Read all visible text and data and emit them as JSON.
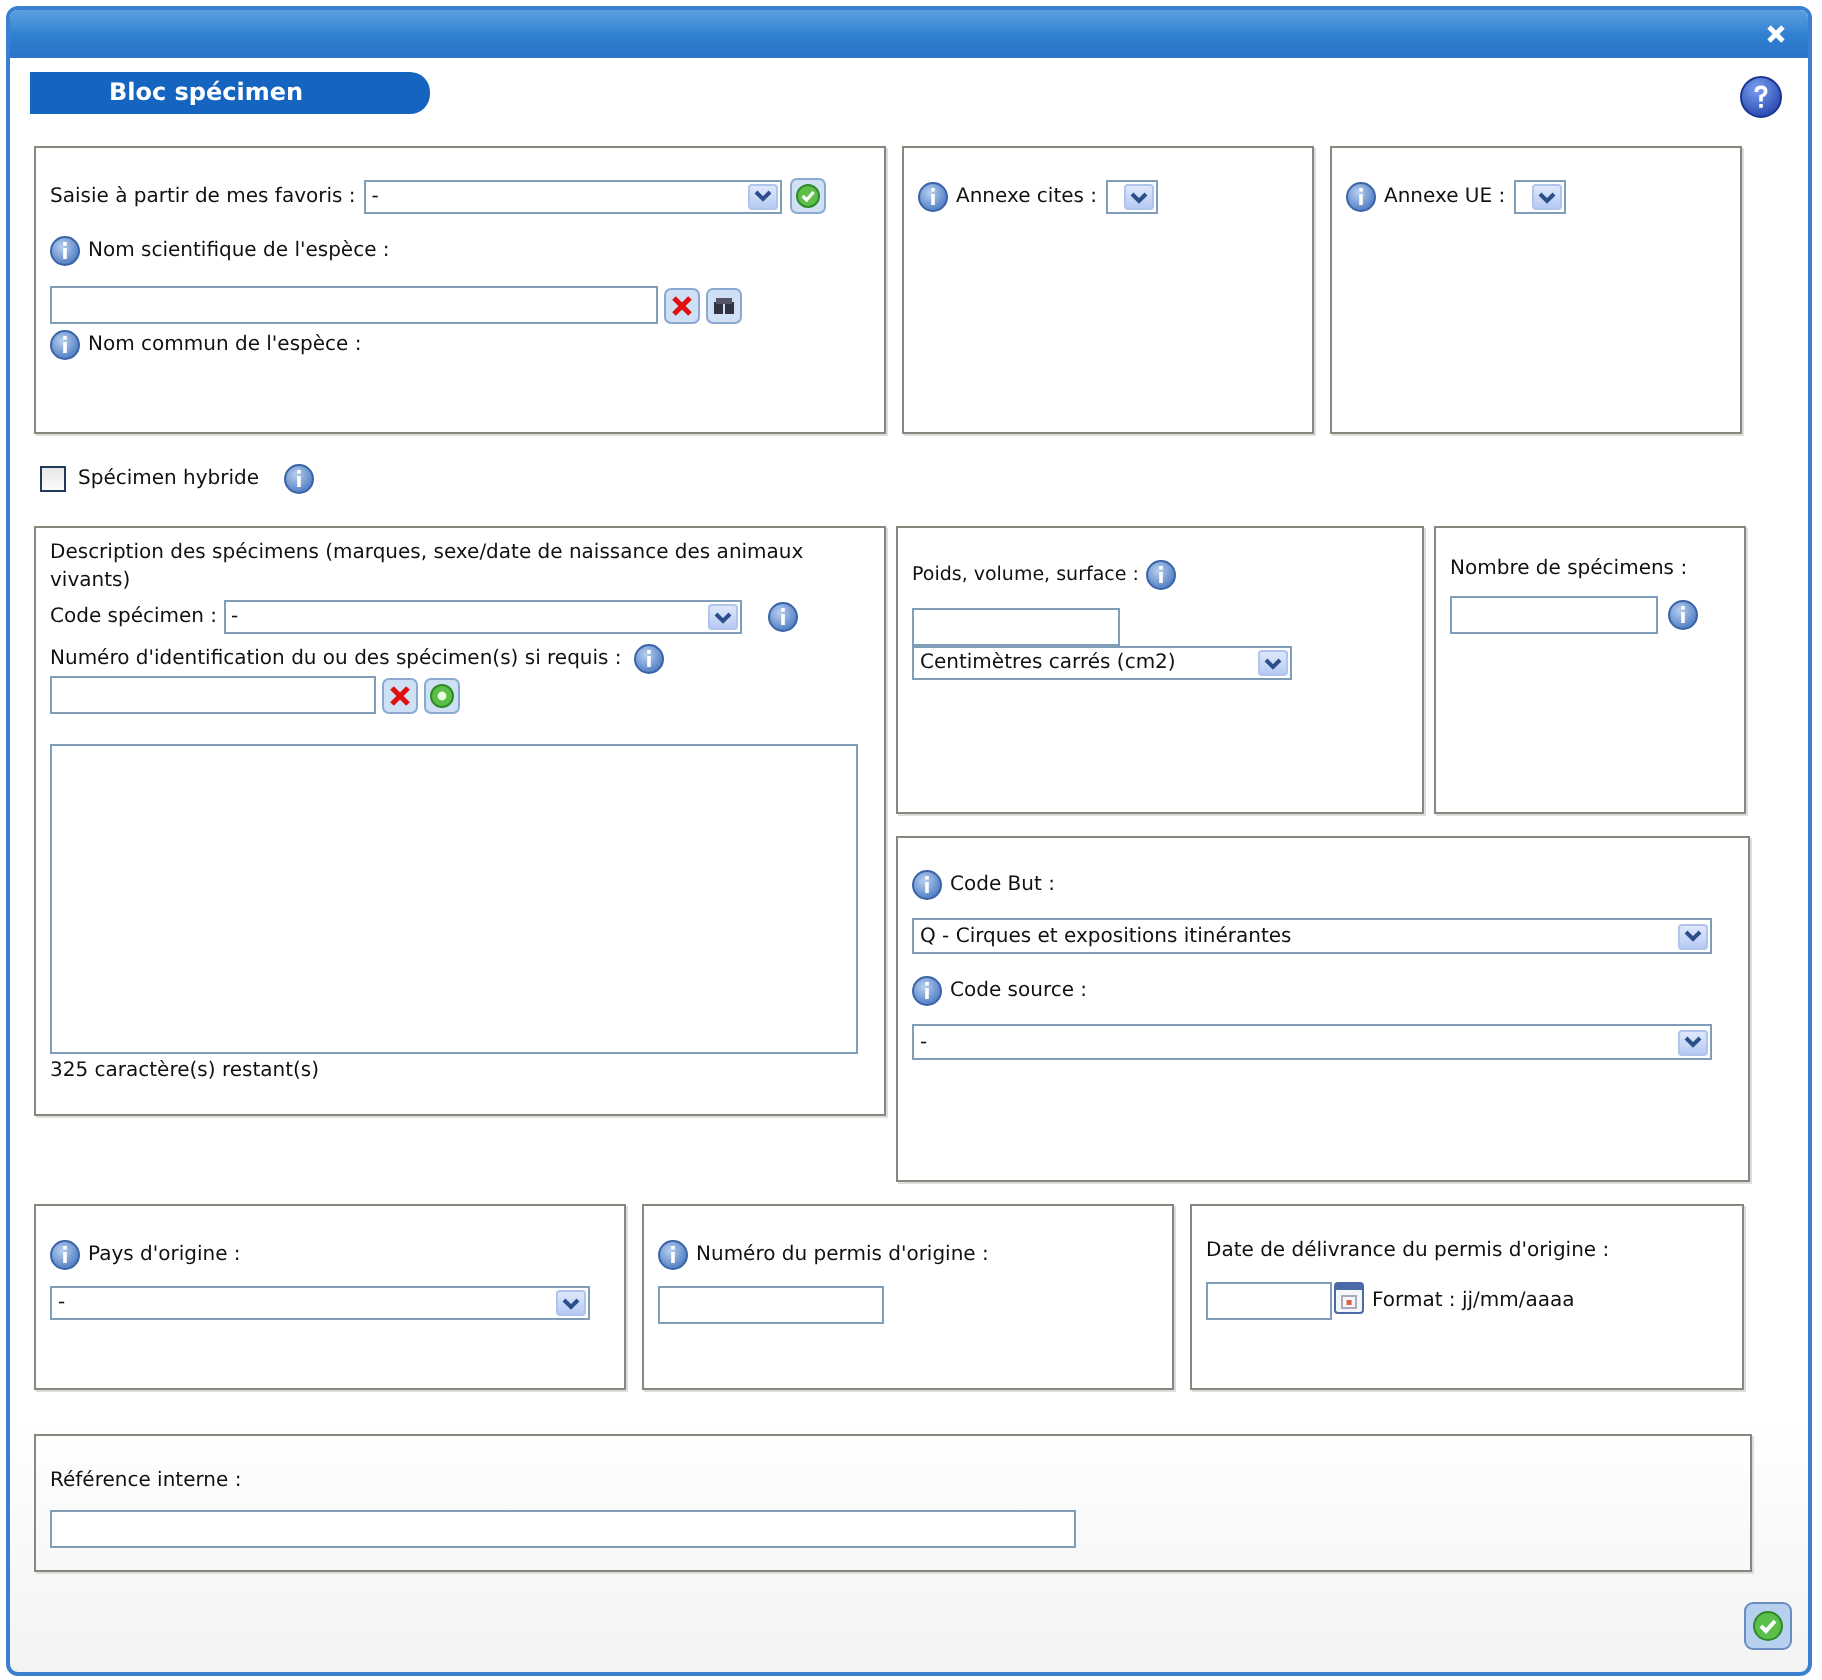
{
  "section_title": "Bloc spécimen",
  "favorites": {
    "label": "Saisie à partir de mes favoris :",
    "value": "-"
  },
  "scientific_name": {
    "label": "Nom scientifique de l'espèce :",
    "info_before": true
  },
  "common_name": {
    "label": "Nom commun de l'espèce :",
    "info_before": true
  },
  "annexe_cites": {
    "label": "Annexe cites :",
    "info_before": true
  },
  "annexe_ue": {
    "label": "Annexe UE :",
    "info_before": true
  },
  "hybrid": {
    "label": "Spécimen hybride",
    "checked": false,
    "info_after": true
  },
  "description": {
    "label": "Description des spécimens (marques, sexe/date de naissance des animaux vivants)",
    "code_label": "Code spécimen :",
    "code_value": "-",
    "code_info_after": true,
    "id_label": "Numéro d'identification du ou des spécimen(s) si requis :",
    "id_info_after": true,
    "counter": "325 caractère(s) restant(s)"
  },
  "measure": {
    "label": "Poids, volume, surface  :",
    "info_after": true,
    "unit": "Centimètres carrés (cm2)"
  },
  "count": {
    "label": "Nombre de spécimens :",
    "info_after": true
  },
  "purpose": {
    "label": "Code But :",
    "info_before": true,
    "value": "Q - Cirques et expositions itinérantes"
  },
  "source": {
    "label": "Code source :",
    "info_before": true,
    "value": "-"
  },
  "origin_country": {
    "label": "Pays d'origine :",
    "info_before": true,
    "value": "-"
  },
  "origin_permit": {
    "label": "Numéro du permis d'origine :",
    "info_before": true
  },
  "permit_date": {
    "label": "Date de délivrance du permis d'origine :",
    "format": "Format : jj/mm/aaaa"
  },
  "internal_ref": {
    "label": "Référence interne :"
  }
}
